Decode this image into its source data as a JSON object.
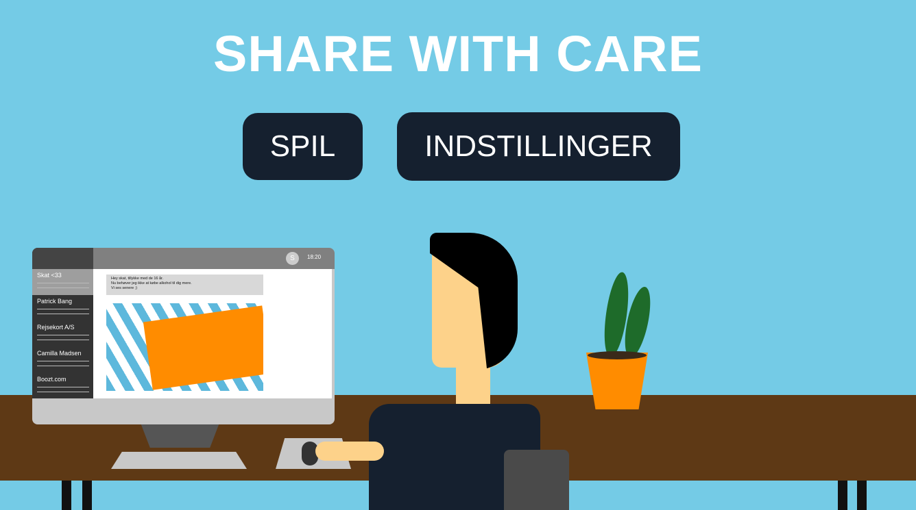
{
  "title": "SHARE WITH CARE",
  "menu": {
    "play_label": "SPIL",
    "settings_label": "INDSTILLINGER"
  },
  "computer": {
    "avatar_initial": "S",
    "time": "18:20",
    "contacts": [
      {
        "name": "Skat <33",
        "active": true
      },
      {
        "name": "Patrick Bang"
      },
      {
        "name": "Rejsekort A/S"
      },
      {
        "name": "Camilla Madsen"
      },
      {
        "name": "Boozt.com"
      }
    ],
    "message": [
      "Hey skat, tillykke med de 16 år.",
      "Nu behøver jeg ikke at købe alkohol til dig mere.",
      "Vi ses senere ;)"
    ]
  },
  "colors": {
    "sky": "#74CBE6",
    "button": "#15202F",
    "desk": "#5E3915",
    "skin": "#FDD28A",
    "orange": "#FF8C00"
  }
}
